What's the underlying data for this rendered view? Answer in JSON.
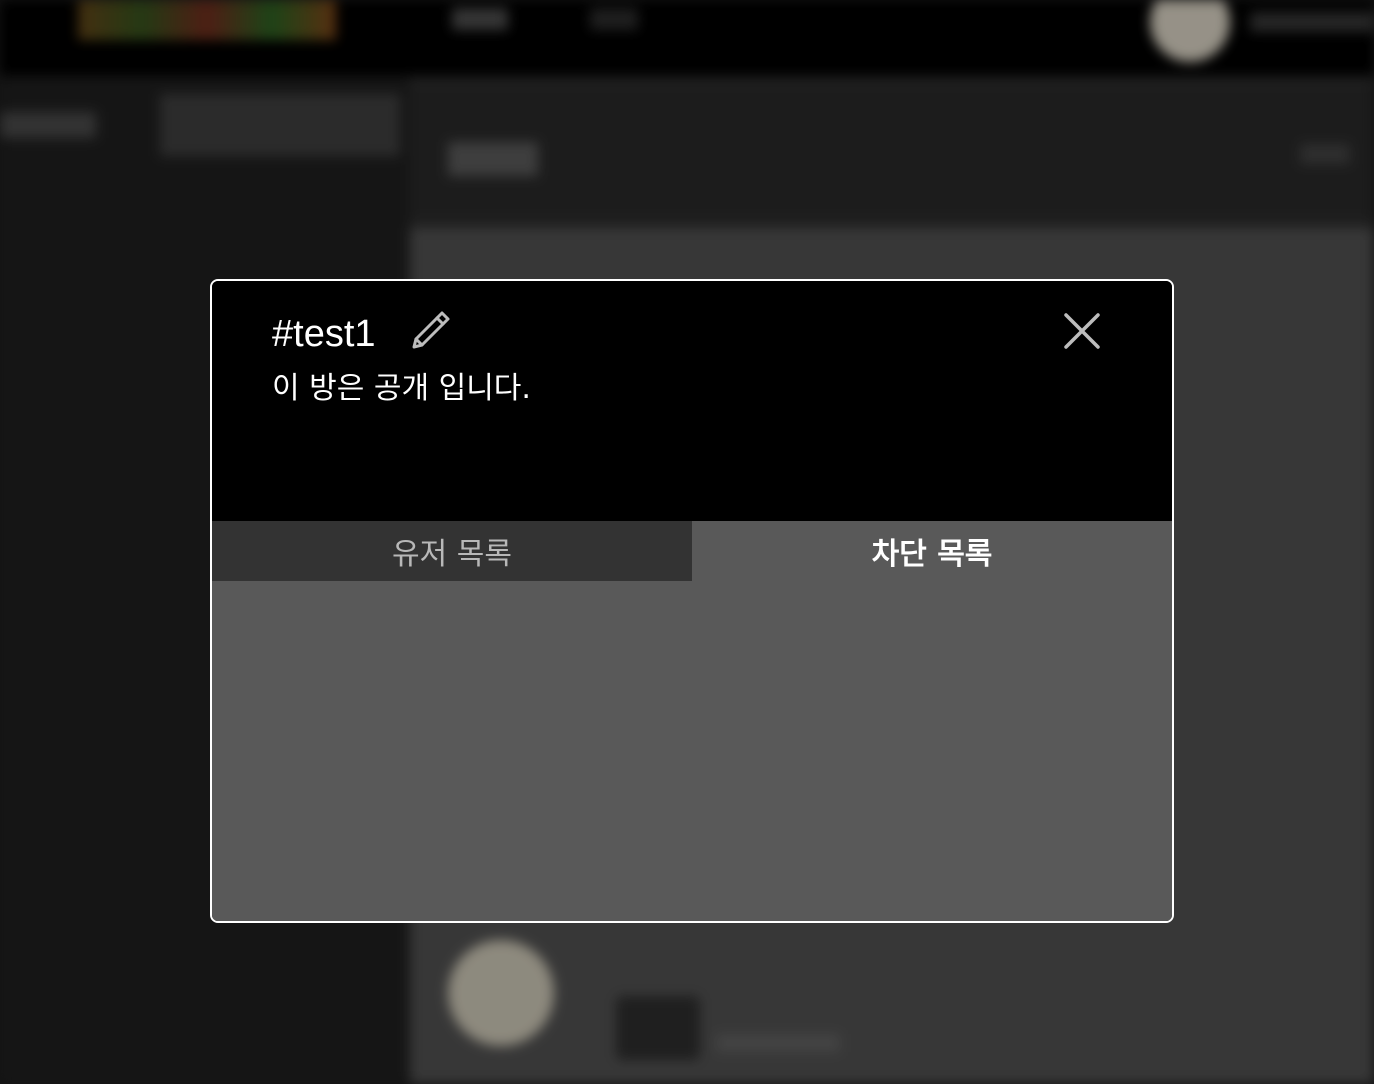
{
  "room": {
    "title": "#test1",
    "description": "이 방은 공개 입니다."
  },
  "tabs": [
    {
      "label": "유저 목록",
      "active": false
    },
    {
      "label": "차단 목록",
      "active": true
    }
  ],
  "icons": {
    "edit": "pencil-icon",
    "close": "close-icon"
  },
  "colors": {
    "modal_border": "#ffffff",
    "header_bg": "#000000",
    "tab_inactive_bg": "#333333",
    "tab_active_bg": "#595959"
  }
}
